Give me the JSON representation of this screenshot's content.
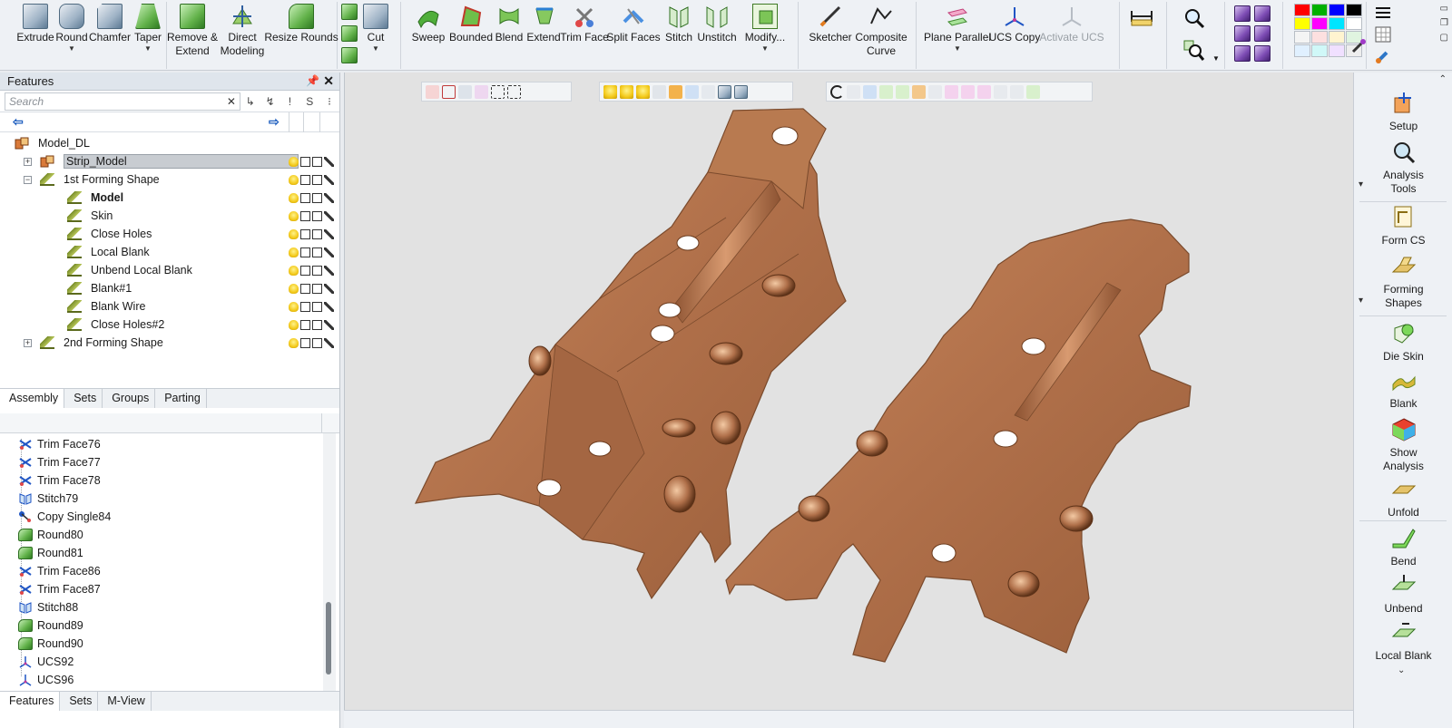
{
  "ribbon": {
    "extrude": "Extrude",
    "round": "Round",
    "chamfer": "Chamfer",
    "taper": "Taper",
    "remove_extend": "Remove &",
    "remove_extend2": "Extend",
    "direct_modeling": "Direct",
    "direct_modeling2": "Modeling",
    "resize_rounds": "Resize Rounds",
    "cut": "Cut",
    "sweep": "Sweep",
    "bounded": "Bounded",
    "blend": "Blend",
    "extend": "Extend",
    "trim_face": "Trim Face",
    "split_faces": "Split Faces",
    "stitch": "Stitch",
    "unstitch": "Unstitch",
    "modify": "Modify...",
    "sketcher": "Sketcher",
    "composite_curve": "Composite",
    "composite_curve2": "Curve",
    "plane_parallel": "Plane Parallel",
    "ucs_copy": "UCS Copy",
    "activate_ucs": "Activate UCS"
  },
  "features_panel": {
    "title": "Features",
    "search_placeholder": "Search",
    "filter_s": "S",
    "tree": [
      {
        "label": "Model_DL",
        "level": 0
      },
      {
        "label": "Strip_Model",
        "level": 1
      },
      {
        "label": "1st Forming Shape",
        "level": 1
      },
      {
        "label": "Model",
        "level": 2
      },
      {
        "label": "Skin",
        "level": 2
      },
      {
        "label": "Close Holes",
        "level": 2
      },
      {
        "label": "Local Blank",
        "level": 2
      },
      {
        "label": "Unbend Local Blank",
        "level": 2
      },
      {
        "label": "Blank#1",
        "level": 2
      },
      {
        "label": "Blank Wire",
        "level": 2
      },
      {
        "label": "Close Holes#2",
        "level": 2
      },
      {
        "label": "2nd Forming Shape",
        "level": 1
      }
    ],
    "tabs": [
      "Assembly",
      "Sets",
      "Groups",
      "Parting"
    ]
  },
  "history": {
    "items": [
      {
        "label": "Trim Face76",
        "icon": "trim-face-icon"
      },
      {
        "label": "Trim Face77",
        "icon": "trim-face-icon"
      },
      {
        "label": "Trim Face78",
        "icon": "trim-face-icon"
      },
      {
        "label": "Stitch79",
        "icon": "stitch-icon"
      },
      {
        "label": "Copy Single84",
        "icon": "copy-icon"
      },
      {
        "label": "Round80",
        "icon": "round-icon"
      },
      {
        "label": "Round81",
        "icon": "round-icon"
      },
      {
        "label": "Trim Face86",
        "icon": "trim-face-icon"
      },
      {
        "label": "Trim Face87",
        "icon": "trim-face-icon"
      },
      {
        "label": "Stitch88",
        "icon": "stitch-icon"
      },
      {
        "label": "Round89",
        "icon": "round-icon"
      },
      {
        "label": "Round90",
        "icon": "round-icon"
      },
      {
        "label": "UCS92",
        "icon": "ucs-icon"
      },
      {
        "label": "UCS96",
        "icon": "ucs-icon"
      }
    ],
    "tabs": [
      "Features",
      "Sets",
      "M-View"
    ]
  },
  "right_panel": {
    "setup": "Setup",
    "analysis_tools": "Analysis",
    "analysis_tools2": "Tools",
    "form_cs": "Form CS",
    "forming_shapes": "Forming",
    "forming_shapes2": "Shapes",
    "die_skin": "Die Skin",
    "blank": "Blank",
    "show_analysis": "Show",
    "show_analysis2": "Analysis",
    "unfold": "Unfold",
    "bend": "Bend",
    "unbend": "Unbend",
    "local_blank": "Local Blank"
  },
  "colors": {
    "part_copper": "#b0704a",
    "part_edge": "#7a4a2c",
    "viewport_bg": "#e2e2e2",
    "selection": "#c8ccd1"
  }
}
